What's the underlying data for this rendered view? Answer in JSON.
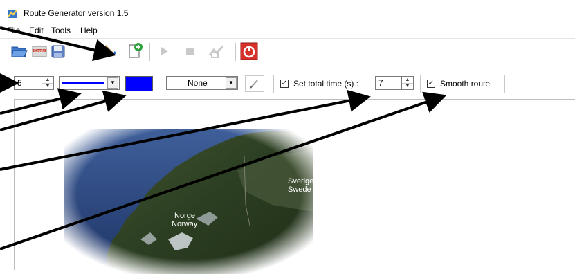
{
  "window": {
    "title": "Route Generator version 1.5"
  },
  "menu": {
    "items": [
      "File",
      "Edit",
      "Tools",
      "Help"
    ]
  },
  "toolbar": {
    "icons": [
      "open-folder-icon",
      "google-earth-icon",
      "save-icon",
      "edit-route-icon",
      "new-page-icon",
      "play-icon",
      "stop-icon",
      "route-tool-icon",
      "power-icon"
    ]
  },
  "options": {
    "line_width": "5",
    "line_style": "solid",
    "color": "#0000ff",
    "marker_value": "None",
    "total_time_label": "Set total time (s) :",
    "total_time_checked": true,
    "total_time_value": "7",
    "smooth_label": "Smooth route",
    "smooth_checked": true
  },
  "map": {
    "label_country_1": "Sverige",
    "label_country_1_en": "Swede",
    "label_country_2": "Norge",
    "label_country_2_en": "Norway"
  }
}
